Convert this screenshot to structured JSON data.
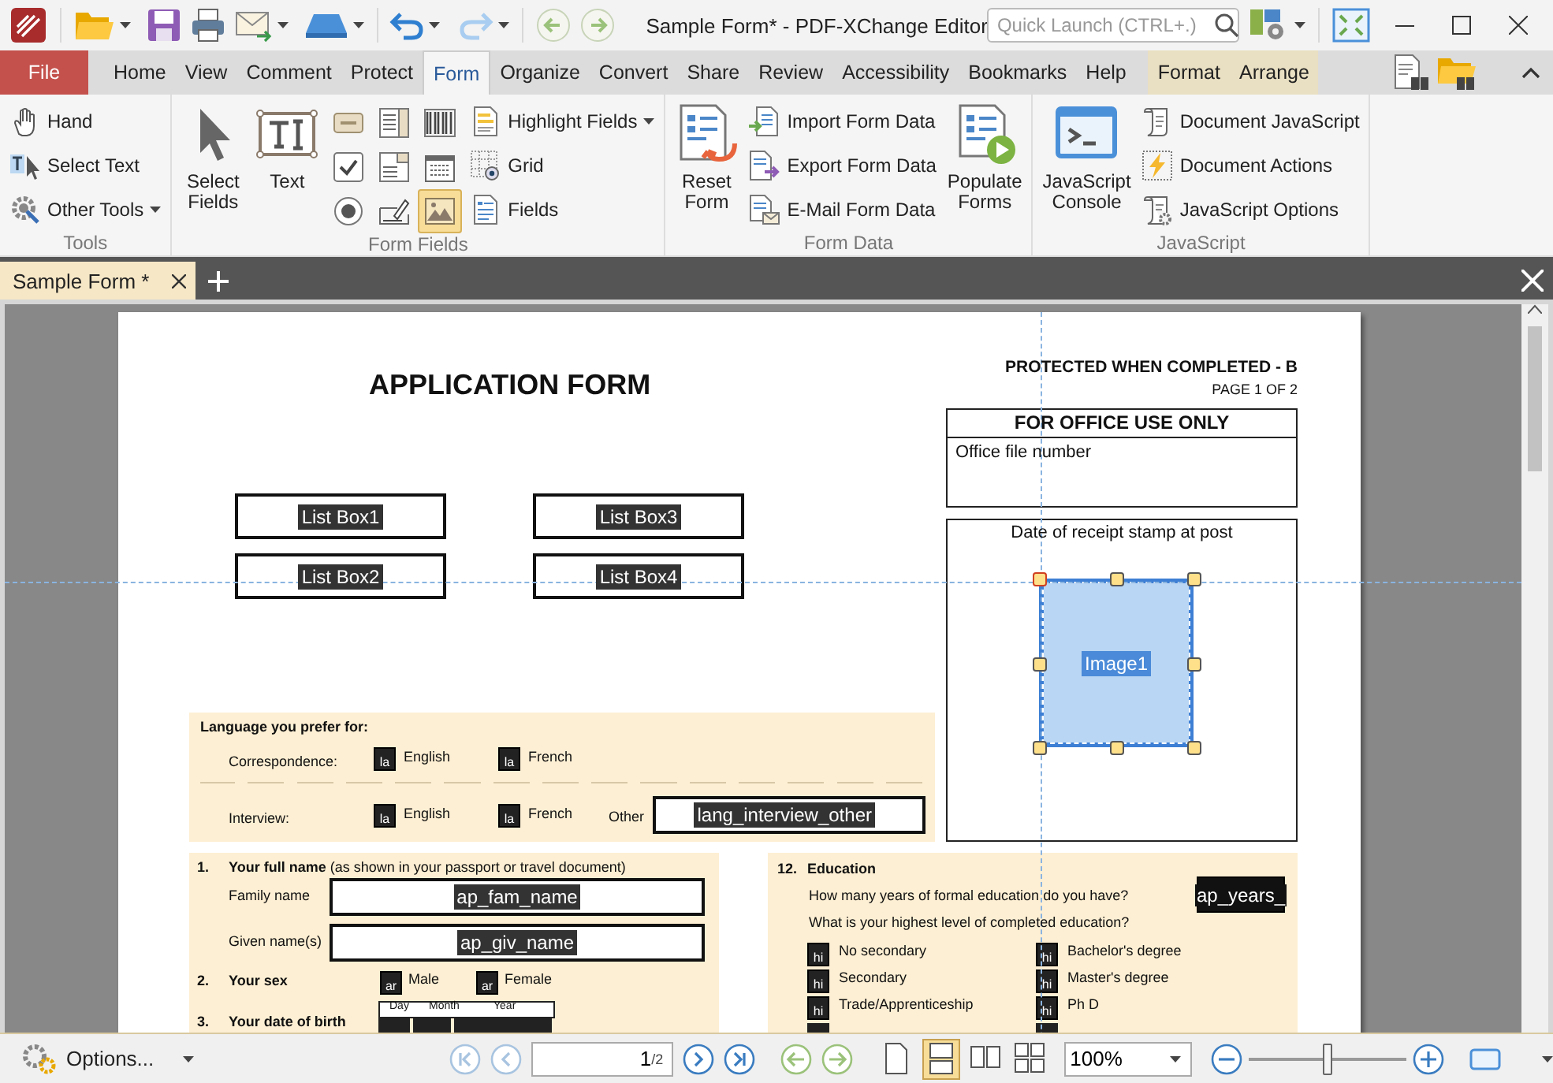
{
  "window": {
    "title": "Sample Form* - PDF-XChange Editor"
  },
  "quick_launch": {
    "placeholder": "Quick Launch (CTRL+.)"
  },
  "ribbon_tabs": [
    {
      "label": "File",
      "kind": "file",
      "selected": false
    },
    {
      "label": "Home",
      "kind": "tab",
      "selected": false
    },
    {
      "label": "View",
      "kind": "tab",
      "selected": false
    },
    {
      "label": "Comment",
      "kind": "tab",
      "selected": false
    },
    {
      "label": "Protect",
      "kind": "tab",
      "selected": false
    },
    {
      "label": "Form",
      "kind": "tab",
      "selected": true
    },
    {
      "label": "Organize",
      "kind": "tab",
      "selected": false
    },
    {
      "label": "Convert",
      "kind": "tab",
      "selected": false
    },
    {
      "label": "Share",
      "kind": "tab",
      "selected": false
    },
    {
      "label": "Review",
      "kind": "tab",
      "selected": false
    },
    {
      "label": "Accessibility",
      "kind": "tab",
      "selected": false
    },
    {
      "label": "Bookmarks",
      "kind": "tab",
      "selected": false
    },
    {
      "label": "Help",
      "kind": "tab",
      "selected": false
    },
    {
      "label": "Format",
      "kind": "context",
      "selected": false
    },
    {
      "label": "Arrange",
      "kind": "context",
      "selected": false
    }
  ],
  "ribbon_groups": [
    {
      "title": "Tools",
      "controls": [
        {
          "kind": "stack",
          "items": [
            {
              "label": "Hand",
              "dropdown": false
            },
            {
              "label": "Select Text",
              "dropdown": false
            },
            {
              "label": "Other Tools",
              "dropdown": true
            }
          ]
        }
      ]
    },
    {
      "title": "Form Fields",
      "controls": [
        {
          "kind": "large",
          "label": "Select Fields"
        },
        {
          "kind": "large",
          "label": "Text"
        },
        {
          "kind": "icon_grid",
          "items": [
            {
              "selected": false
            },
            {
              "selected": false
            },
            {
              "selected": false
            },
            {
              "selected": false
            },
            {
              "selected": false
            },
            {
              "selected": false
            },
            {
              "selected": false
            },
            {
              "selected": false
            },
            {
              "selected": true
            }
          ]
        },
        {
          "kind": "stack",
          "items": [
            {
              "label": "Highlight Fields",
              "dropdown": true
            },
            {
              "label": "Grid",
              "dropdown": false
            },
            {
              "label": "Fields",
              "dropdown": false
            }
          ]
        }
      ]
    },
    {
      "title": "Form Data",
      "controls": [
        {
          "kind": "large",
          "label": "Reset Form"
        },
        {
          "kind": "stack",
          "items": [
            {
              "label": "Import Form Data",
              "dropdown": false
            },
            {
              "label": "Export Form Data",
              "dropdown": false
            },
            {
              "label": "E-Mail Form Data",
              "dropdown": false
            }
          ]
        },
        {
          "kind": "large",
          "label": "Populate Forms"
        }
      ]
    },
    {
      "title": "JavaScript",
      "controls": [
        {
          "kind": "large",
          "label": "JavaScript Console"
        },
        {
          "kind": "stack",
          "items": [
            {
              "label": "Document JavaScript",
              "dropdown": false
            },
            {
              "label": "Document Actions",
              "dropdown": false
            },
            {
              "label": "JavaScript Options",
              "dropdown": false
            }
          ]
        }
      ]
    }
  ],
  "document_tabs": [
    {
      "label": "Sample Form *",
      "selected": true
    }
  ],
  "page": {
    "title": "APPLICATION FORM",
    "header": [
      "PROTECTED WHEN COMPLETED - B",
      "PAGE 1 OF 2"
    ],
    "list_boxes": [
      "List Box1",
      "List Box3",
      "List Box2",
      "List Box4"
    ],
    "office_box": {
      "heading": "FOR OFFICE USE ONLY",
      "label": "Office file number"
    },
    "stamp_box": {
      "label": "Date of receipt stamp at post"
    },
    "image_field": {
      "label": "Image1",
      "selected": true
    },
    "language": {
      "heading": "Language you prefer for:",
      "rows": [
        {
          "label": "Correspondence:",
          "options": [
            {
              "field": "la",
              "label": "English"
            },
            {
              "field": "la",
              "label": "French"
            }
          ]
        },
        {
          "label": "Interview:",
          "options": [
            {
              "field": "la",
              "label": "English"
            },
            {
              "field": "la",
              "label": "French"
            }
          ],
          "other": {
            "label": "Other",
            "field": "lang_interview_other"
          }
        }
      ]
    },
    "section_1": {
      "number": "1.",
      "heading": "**Your full name** (as shown in your passport or travel document)",
      "fields": [
        {
          "label": "Family name",
          "field": "ap_fam_name"
        },
        {
          "label": "Given name(s)",
          "field": "ap_giv_name"
        }
      ]
    },
    "section_2": {
      "number": "2.",
      "heading": "Your sex",
      "options": [
        {
          "field": "ar",
          "label": "Male"
        },
        {
          "field": "ar",
          "label": "Female"
        }
      ]
    },
    "section_3": {
      "number": "3.",
      "heading": "Your date of birth",
      "date_columns": [
        "Day",
        "Month",
        "Year"
      ]
    },
    "section_12": {
      "number": "12.",
      "heading": "Education",
      "question_1": "How many years of formal education do you have?",
      "years_field": "ap_years_",
      "question_2": "What is your highest level of completed education?",
      "options": [
        {
          "field": "hi",
          "label": "No secondary"
        },
        {
          "field": "hi",
          "label": "Secondary"
        },
        {
          "field": "hi",
          "label": "Trade/Apprenticeship"
        },
        {
          "field": "hi",
          "label": "Bachelor's degree"
        },
        {
          "field": "hi",
          "label": "Master's degree"
        },
        {
          "field": "hi",
          "label": "Ph D"
        }
      ]
    }
  },
  "status_bar": {
    "options": "Options...",
    "page_number": "1",
    "page_total": "/2",
    "view_modes": [
      {
        "selected": false
      },
      {
        "selected": true
      },
      {
        "selected": false
      },
      {
        "selected": false
      }
    ],
    "zoom": "100%",
    "zoom_slider": {
      "level": 0.5
    }
  }
}
